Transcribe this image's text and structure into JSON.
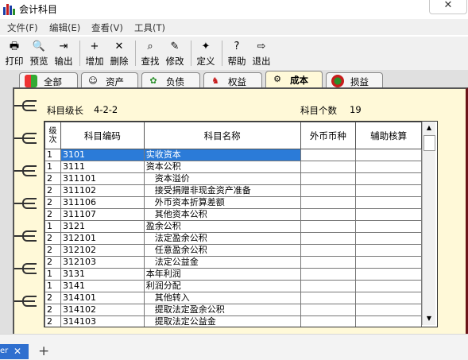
{
  "window": {
    "title": "会计科目",
    "close_glyph": "✕"
  },
  "menu": [
    "文件(F)",
    "编辑(E)",
    "查看(V)",
    "工具(T)"
  ],
  "toolbar": [
    {
      "label": "打印",
      "icon": "printer-icon",
      "glyph": "🖶"
    },
    {
      "label": "预览",
      "icon": "preview-icon",
      "glyph": "🔍"
    },
    {
      "label": "输出",
      "icon": "export-icon",
      "glyph": "⇥"
    },
    {
      "label": "增加",
      "icon": "add-icon",
      "glyph": "+"
    },
    {
      "label": "删除",
      "icon": "delete-icon",
      "glyph": "✕"
    },
    {
      "label": "查找",
      "icon": "find-icon",
      "glyph": "⌕"
    },
    {
      "label": "修改",
      "icon": "edit-icon",
      "glyph": "✎"
    },
    {
      "label": "定义",
      "icon": "wand-icon",
      "glyph": "✦"
    },
    {
      "label": "帮助",
      "icon": "help-icon",
      "glyph": "?"
    },
    {
      "label": "退出",
      "icon": "exit-icon",
      "glyph": "⇨"
    }
  ],
  "tabs": [
    {
      "label": "全部",
      "icon": "all-icon"
    },
    {
      "label": "资产",
      "icon": "asset-icon"
    },
    {
      "label": "负债",
      "icon": "liability-icon"
    },
    {
      "label": "权益",
      "icon": "equity-icon"
    },
    {
      "label": "成本",
      "icon": "cost-icon",
      "active": true
    },
    {
      "label": "损益",
      "icon": "profit-loss-icon"
    }
  ],
  "info": {
    "level_label": "科目级长",
    "level_value": "4-2-2",
    "count_label": "科目个数",
    "count_value": "19"
  },
  "columns": [
    "级次",
    "科目编码",
    "科目名称",
    "外币币种",
    "辅助核算"
  ],
  "rows": [
    {
      "level": "1",
      "code": "3101",
      "name": "实收资本",
      "selected": true
    },
    {
      "level": "1",
      "code": "3111",
      "name": "资本公积"
    },
    {
      "level": "2",
      "code": "311101",
      "name": "　资本溢价"
    },
    {
      "level": "2",
      "code": "311102",
      "name": "　接受捐赠非现金资产准备"
    },
    {
      "level": "2",
      "code": "311106",
      "name": "　外币资本折算差额"
    },
    {
      "level": "2",
      "code": "311107",
      "name": "　其他资本公积"
    },
    {
      "level": "1",
      "code": "3121",
      "name": "盈余公积"
    },
    {
      "level": "2",
      "code": "312101",
      "name": "　法定盈余公积"
    },
    {
      "level": "2",
      "code": "312102",
      "name": "　任意盈余公积"
    },
    {
      "level": "2",
      "code": "312103",
      "name": "　法定公益金"
    },
    {
      "level": "1",
      "code": "3131",
      "name": "本年利润"
    },
    {
      "level": "1",
      "code": "3141",
      "name": "利润分配"
    },
    {
      "level": "2",
      "code": "314101",
      "name": "　其他转入"
    },
    {
      "level": "2",
      "code": "314102",
      "name": "　提取法定盈余公积"
    },
    {
      "level": "2",
      "code": "314103",
      "name": "　提取法定公益金"
    }
  ],
  "taskbar": {
    "tab_label": "er",
    "close_glyph": "✕",
    "plus_glyph": "+"
  },
  "colors": {
    "selection": "#2b7bd8",
    "page": "#fff9d8",
    "book_edge": "#6b1418"
  }
}
